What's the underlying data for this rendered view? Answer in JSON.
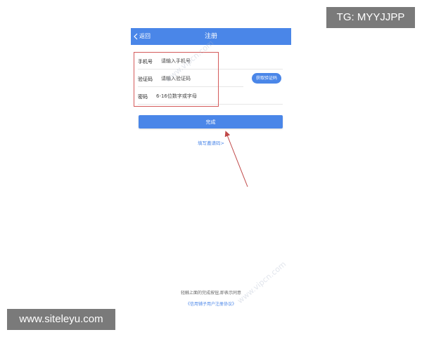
{
  "header": {
    "back_label": "返回",
    "title": "注册",
    "back_icon": "chevron-left-icon"
  },
  "form": {
    "phone": {
      "label": "手机号",
      "placeholder": "请输入手机号"
    },
    "code": {
      "label": "验证码",
      "placeholder": "请输入验证码",
      "button_label": "获取验证码"
    },
    "password": {
      "label": "密码",
      "placeholder": "6-16位数字或字母"
    }
  },
  "done_label": "完成",
  "invite_link": "填写邀请码>",
  "agreement": {
    "text": "轻触上面的完成按钮,即表示同意",
    "link": "《信用铺子用户注册协议》"
  },
  "watermarks": {
    "top": "www.vipcn.com",
    "bottom": "www.vipcn.com"
  },
  "overlays": {
    "tg": "TG: MYYJJPP",
    "site": "www.siteleyu.com"
  },
  "colors": {
    "accent": "#4a86e8",
    "annotation": "#d45a5a"
  }
}
